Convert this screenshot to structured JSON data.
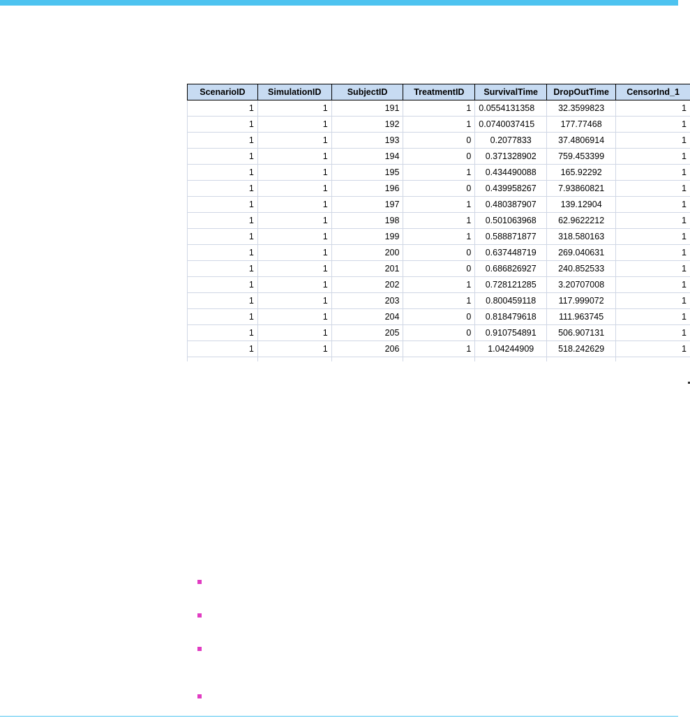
{
  "colors": {
    "accent": "#4dc3f0",
    "header_fill": "#c7dbf2",
    "bullet": "#e13cc2"
  },
  "table": {
    "headers": [
      "ScenarioID",
      "SimulationID",
      "SubjectID",
      "TreatmentID",
      "SurvivalTime",
      "DropOutTime",
      "CensorInd_1"
    ],
    "rows": [
      [
        "1",
        "1",
        "191",
        "1",
        "0.0554131358",
        "32.3599823",
        "1"
      ],
      [
        "1",
        "1",
        "192",
        "1",
        "0.0740037415",
        "177.77468",
        "1"
      ],
      [
        "1",
        "1",
        "193",
        "0",
        "0.2077833",
        "37.4806914",
        "1"
      ],
      [
        "1",
        "1",
        "194",
        "0",
        "0.371328902",
        "759.453399",
        "1"
      ],
      [
        "1",
        "1",
        "195",
        "1",
        "0.434490088",
        "165.92292",
        "1"
      ],
      [
        "1",
        "1",
        "196",
        "0",
        "0.439958267",
        "7.93860821",
        "1"
      ],
      [
        "1",
        "1",
        "197",
        "1",
        "0.480387907",
        "139.12904",
        "1"
      ],
      [
        "1",
        "1",
        "198",
        "1",
        "0.501063968",
        "62.9622212",
        "1"
      ],
      [
        "1",
        "1",
        "199",
        "1",
        "0.588871877",
        "318.580163",
        "1"
      ],
      [
        "1",
        "1",
        "200",
        "0",
        "0.637448719",
        "269.040631",
        "1"
      ],
      [
        "1",
        "1",
        "201",
        "0",
        "0.686826927",
        "240.852533",
        "1"
      ],
      [
        "1",
        "1",
        "202",
        "1",
        "0.728121285",
        "3.20707008",
        "1"
      ],
      [
        "1",
        "1",
        "203",
        "1",
        "0.800459118",
        "117.999072",
        "1"
      ],
      [
        "1",
        "1",
        "204",
        "0",
        "0.818479618",
        "111.963745",
        "1"
      ],
      [
        "1",
        "1",
        "205",
        "0",
        "0.910754891",
        "506.907131",
        "1"
      ],
      [
        "1",
        "1",
        "206",
        "1",
        "1.04244909",
        "518.242629",
        "1"
      ]
    ]
  }
}
